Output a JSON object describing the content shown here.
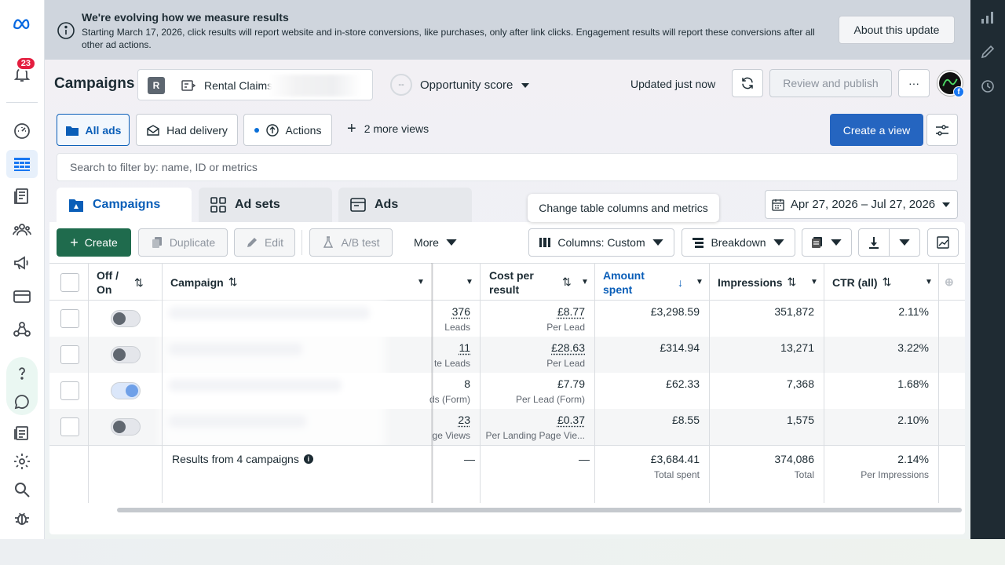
{
  "banner": {
    "title": "We're evolving how we measure results",
    "text": "Starting March 17, 2026, click results will report website and in-store conversions, like purchases, only after link clicks. Engagement results will report these conversions after all other ad actions.",
    "about_button": "About this update"
  },
  "leftrail": {
    "notifications_count": "23"
  },
  "header": {
    "title": "Campaigns",
    "account_initial": "R",
    "account_name": "Rental Claims",
    "opportunity_dash": "--",
    "opportunity_label": "Opportunity score",
    "updated": "Updated just now",
    "review_button": "Review and publish",
    "more_button": "···"
  },
  "views": {
    "all_ads": "All ads",
    "had_delivery": "Had delivery",
    "actions": "Actions",
    "more_views": "2 more views",
    "create_view": "Create a view"
  },
  "search": {
    "placeholder": "Search to filter by: name, ID or metrics"
  },
  "tabs": {
    "campaigns": "Campaigns",
    "ad_sets": "Ad sets",
    "ads": "Ads"
  },
  "tooltip": "Change table columns and metrics",
  "date_range": "Apr 27, 2026 – Jul 27, 2026",
  "toolbar": {
    "create": "Create",
    "duplicate": "Duplicate",
    "edit": "Edit",
    "ab_test": "A/B test",
    "more": "More",
    "columns": "Columns: Custom",
    "breakdown": "Breakdown"
  },
  "table": {
    "headers": {
      "off_on": "Off / On",
      "campaign": "Campaign",
      "cost_per_result": "Cost per result",
      "amount_spent": "Amount spent",
      "impressions": "Impressions",
      "ctr": "CTR (all)"
    },
    "rows": [
      {
        "results": "376",
        "results_label": "Leads",
        "cost": "£8.77",
        "cost_label": "Per Lead",
        "spent": "£3,298.59",
        "impressions": "351,872",
        "ctr": "2.11%",
        "on": false
      },
      {
        "results": "11",
        "results_label": "te Leads",
        "cost": "£28.63",
        "cost_label": "Per Lead",
        "spent": "£314.94",
        "impressions": "13,271",
        "ctr": "3.22%",
        "on": false
      },
      {
        "results": "8",
        "results_label": "ds (Form)",
        "cost": "£7.79",
        "cost_label": "Per Lead (Form)",
        "spent": "£62.33",
        "impressions": "7,368",
        "ctr": "1.68%",
        "on": true
      },
      {
        "results": "23",
        "results_label": "ge Views",
        "cost": "£0.37",
        "cost_label": "Per Landing Page Vie...",
        "spent": "£8.55",
        "impressions": "1,575",
        "ctr": "2.10%",
        "on": false
      }
    ],
    "footer": {
      "label": "Results from 4 campaigns",
      "results": "—",
      "cost": "—",
      "spent": "£3,684.41",
      "spent_label": "Total spent",
      "impressions": "374,086",
      "impressions_label": "Total",
      "ctr": "2.14%",
      "ctr_label": "Per Impressions"
    }
  }
}
